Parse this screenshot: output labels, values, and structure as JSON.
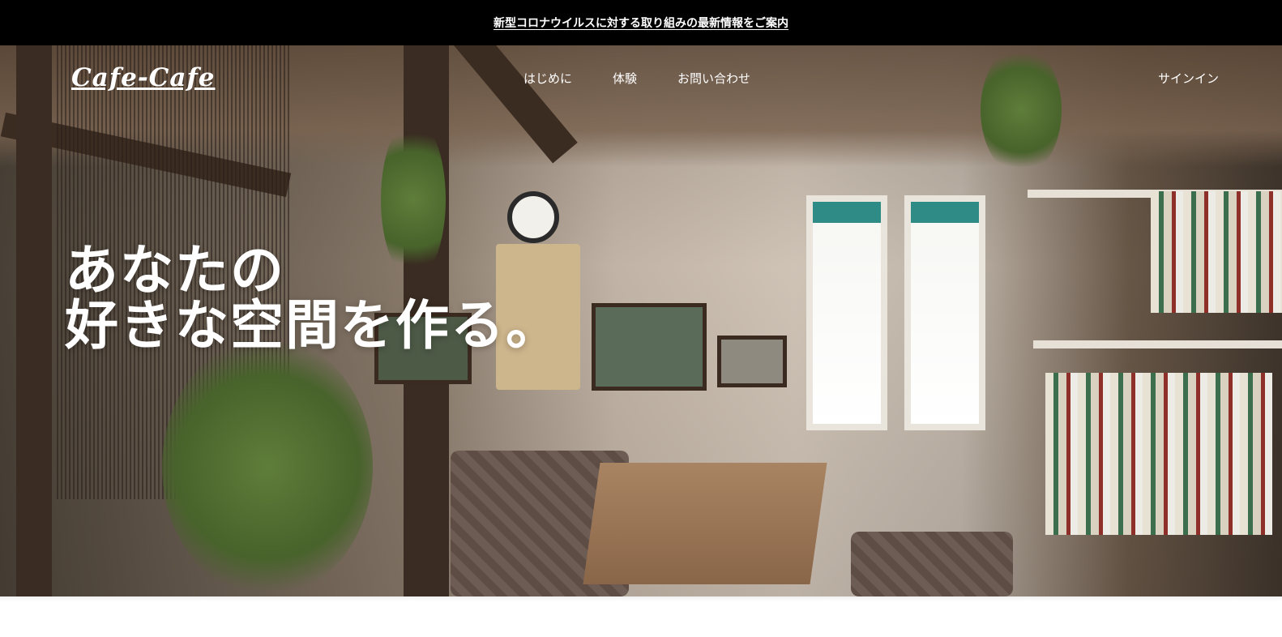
{
  "announcement": {
    "text": "新型コロナウイルスに対する取り組みの最新情報をご案内"
  },
  "header": {
    "logo": "Cafe-Cafe",
    "nav": [
      {
        "label": "はじめに"
      },
      {
        "label": "体験"
      },
      {
        "label": "お問い合わせ"
      }
    ],
    "signin": "サインイン"
  },
  "hero": {
    "headline_line1": "あなたの",
    "headline_line2": "好きな空間を作る。"
  },
  "colors": {
    "announcement_bg": "#000000",
    "text_on_dark": "#ffffff"
  }
}
